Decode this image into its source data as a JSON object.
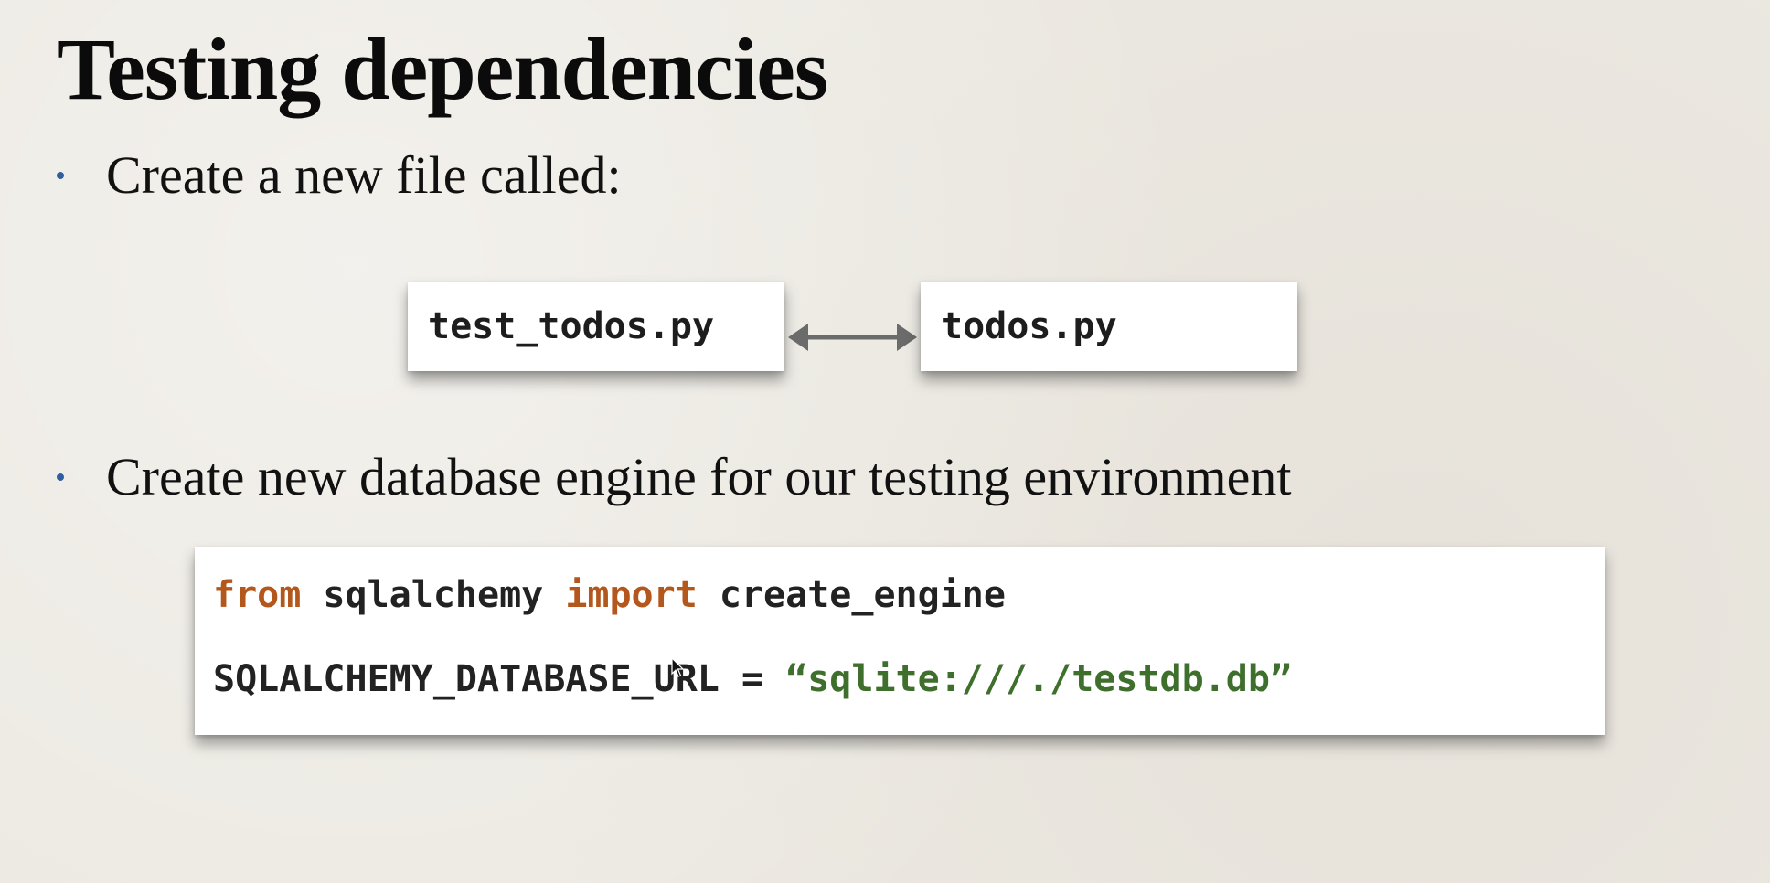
{
  "slide": {
    "title": "Testing dependencies",
    "bullets": [
      "Create a new file called:",
      "Create new database engine for our testing environment"
    ],
    "files": {
      "left": "test_todos.py",
      "right": "todos.py"
    },
    "connector_icon": "double-arrow-icon",
    "code": {
      "line1": {
        "kw_from": "from",
        "module": " sqlalchemy ",
        "kw_import": "import",
        "name": " create_engine"
      },
      "line2": {
        "var": "SQLALCHEMY_DATABASE_URL = ",
        "value": "“sqlite:///./testdb.db”"
      }
    },
    "colors": {
      "keyword": "#b4571c",
      "string": "#3f6f2c",
      "bullet": "#2f5f9f"
    }
  }
}
